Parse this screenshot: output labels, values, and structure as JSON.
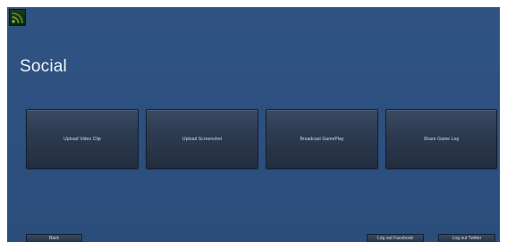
{
  "app": {
    "logo_icon": "rss-feed-icon",
    "logo_color": "#5ea12e"
  },
  "page": {
    "title": "Social"
  },
  "actions": [
    {
      "label": "Upload Video Clip"
    },
    {
      "label": "Upload Screenshot"
    },
    {
      "label": "Broadcast GamePlay"
    },
    {
      "label": "Share Game Log"
    }
  ],
  "footer": {
    "back_label": "Back",
    "logout_facebook_label": "Log out Facebook",
    "logout_twitter_label": "Log out Twitter"
  },
  "colors": {
    "background": "#2d5080",
    "button": "#2c3a50",
    "text": "#f2f5fa"
  }
}
